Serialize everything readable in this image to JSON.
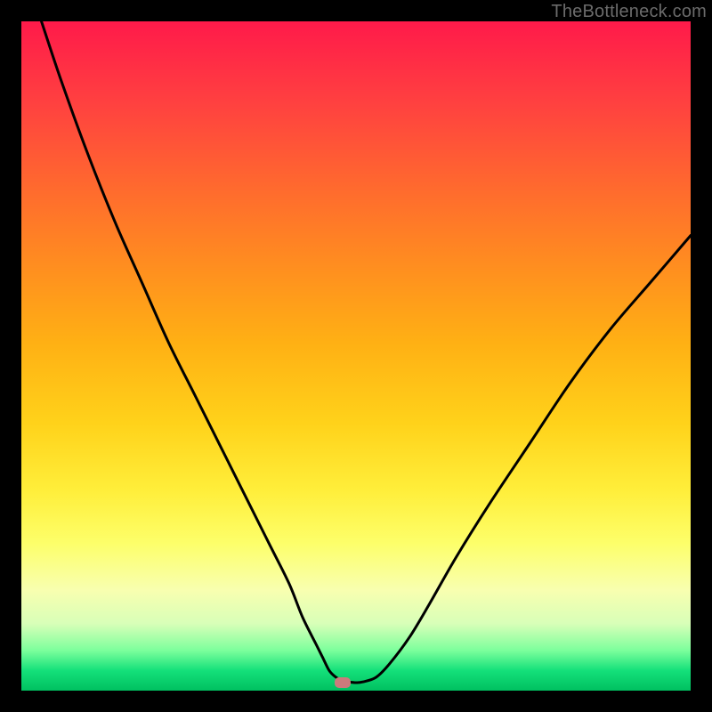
{
  "watermark": "TheBottleneck.com",
  "chart_data": {
    "type": "line",
    "title": "",
    "xlabel": "",
    "ylabel": "",
    "xlim": [
      0,
      100
    ],
    "ylim": [
      0,
      100
    ],
    "series": [
      {
        "name": "bottleneck-curve",
        "x": [
          3,
          6,
          10,
          14,
          18,
          22,
          26,
          30,
          34,
          37,
          40,
          42,
          44,
          45,
          46,
          47,
          48,
          49,
          50,
          51,
          53,
          55,
          58,
          61,
          65,
          70,
          76,
          82,
          88,
          94,
          100
        ],
        "values": [
          100,
          91,
          80,
          70,
          61,
          52,
          44,
          36,
          28,
          22,
          16,
          11,
          7,
          5,
          3,
          2,
          1.5,
          1.3,
          1.2,
          1.3,
          2,
          4,
          8,
          13,
          20,
          28,
          37,
          46,
          54,
          61,
          68
        ]
      }
    ],
    "marker": {
      "x": 48,
      "y": 1.2
    },
    "gradient_stops": [
      {
        "pos": 0.0,
        "color": "#ff1a4a"
      },
      {
        "pos": 0.5,
        "color": "#ffd21a"
      },
      {
        "pos": 0.8,
        "color": "#fdff6a"
      },
      {
        "pos": 0.94,
        "color": "#7cff9c"
      },
      {
        "pos": 1.0,
        "color": "#00c060"
      }
    ]
  }
}
